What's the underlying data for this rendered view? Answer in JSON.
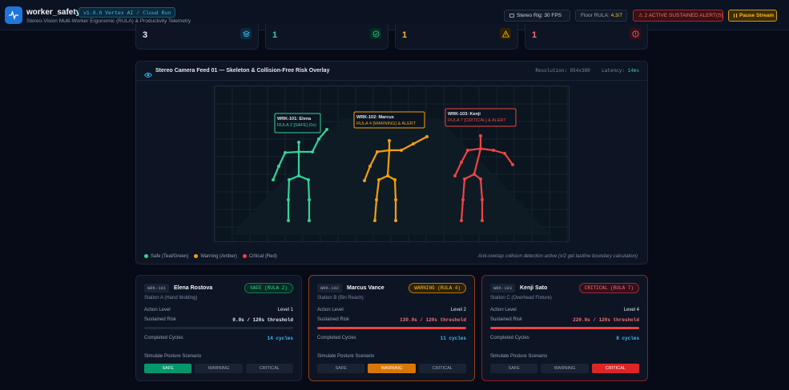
{
  "app": {
    "title": "worker_safety",
    "version": "v1.0.0 Vertex AI / Cloud Run",
    "subtitle": "Stereo-Vision Multi-Worker Ergonomic (RULA) & Productivity Telemetry"
  },
  "header": {
    "fps_label": "Stereo Rig: 30 FPS",
    "rula_label": "Floor RULA:",
    "rula_value": "4.3/7",
    "alerts_label": "2 ACTIVE SUSTAINED ALERT(S)",
    "pause_label": "Pause Stream"
  },
  "stats": [
    {
      "value": "3",
      "color": "#e2e8f0",
      "icon": "layers-icon",
      "accent": "#38bdf8"
    },
    {
      "value": "1",
      "color": "#34d399",
      "icon": "check-circle-icon",
      "accent": "#34d399"
    },
    {
      "value": "1",
      "color": "#fbbf24",
      "icon": "warning-triangle-icon",
      "accent": "#fbbf24"
    },
    {
      "value": "1",
      "color": "#f87171",
      "icon": "alert-circle-icon",
      "accent": "#f87171"
    }
  ],
  "feed": {
    "title": "Stereo Camera Feed 01 — Skeleton & Collision-Free Risk Overlay",
    "resolution": "Resolution: 854x380",
    "latency_label": "Latency:",
    "latency_value": "14ms",
    "legend": {
      "safe": "Safe (Teal/Green)",
      "warning": "Warning (Amber)",
      "critical": "Critical (Red)"
    },
    "note": "Anti-overlap collision detection active (x/2 get lastline boundary calculation)",
    "overlays": [
      {
        "line1": "WRK-101: Elena",
        "line2": "RULA 2 [SAFE] (0s)"
      },
      {
        "line1": "WRK-102: Marcus",
        "line2": "RULA 4 [WARNING] & ALERT"
      },
      {
        "line1": "WRK-103: Kenji",
        "line2": "RULA 7 [CRITICAL] & ALERT"
      }
    ]
  },
  "colors": {
    "safe": "#34d399",
    "warning": "#f59e0b",
    "critical": "#ef4444"
  },
  "workers": [
    {
      "id": "WRK-101",
      "name": "Elena Rostova",
      "station": "Station A (Hand Molding)",
      "status": "SAFE (RULA 2)",
      "action_label": "Action Level",
      "action_value": "Level 1",
      "sustained_label": "Sustained Risk",
      "sustained_value": "0.0s / 120s threshold",
      "sustained_progress": 0,
      "cycles_label": "Completed Cycles",
      "cycles_value": "14 cycles",
      "simulate_label": "Simulate Posture Scenario",
      "buttons": [
        "SAFE",
        "WARNING",
        "CRITICAL"
      ],
      "active": "SAFE"
    },
    {
      "id": "WRK-102",
      "name": "Marcus Vance",
      "station": "Station B (Bin Reach)",
      "status": "WARNING (RULA 4)",
      "action_label": "Action Level",
      "action_value": "Level 2",
      "sustained_label": "Sustained Risk",
      "sustained_value": "130.0s / 120s threshold",
      "sustained_progress": 1,
      "cycles_label": "Completed Cycles",
      "cycles_value": "11 cycles",
      "simulate_label": "Simulate Posture Scenario",
      "buttons": [
        "SAFE",
        "WARNING",
        "CRITICAL"
      ],
      "active": "WARNING"
    },
    {
      "id": "WRK-103",
      "name": "Kenji Sato",
      "station": "Station C (Overhead Fixture)",
      "status": "CRITICAL (RULA 7)",
      "action_label": "Action Level",
      "action_value": "Level 4",
      "sustained_label": "Sustained Risk",
      "sustained_value": "220.0s / 120s threshold",
      "sustained_progress": 1,
      "cycles_label": "Completed Cycles",
      "cycles_value": "8 cycles",
      "simulate_label": "Simulate Posture Scenario",
      "buttons": [
        "SAFE",
        "WARNING",
        "CRITICAL"
      ],
      "active": "CRITICAL"
    }
  ]
}
